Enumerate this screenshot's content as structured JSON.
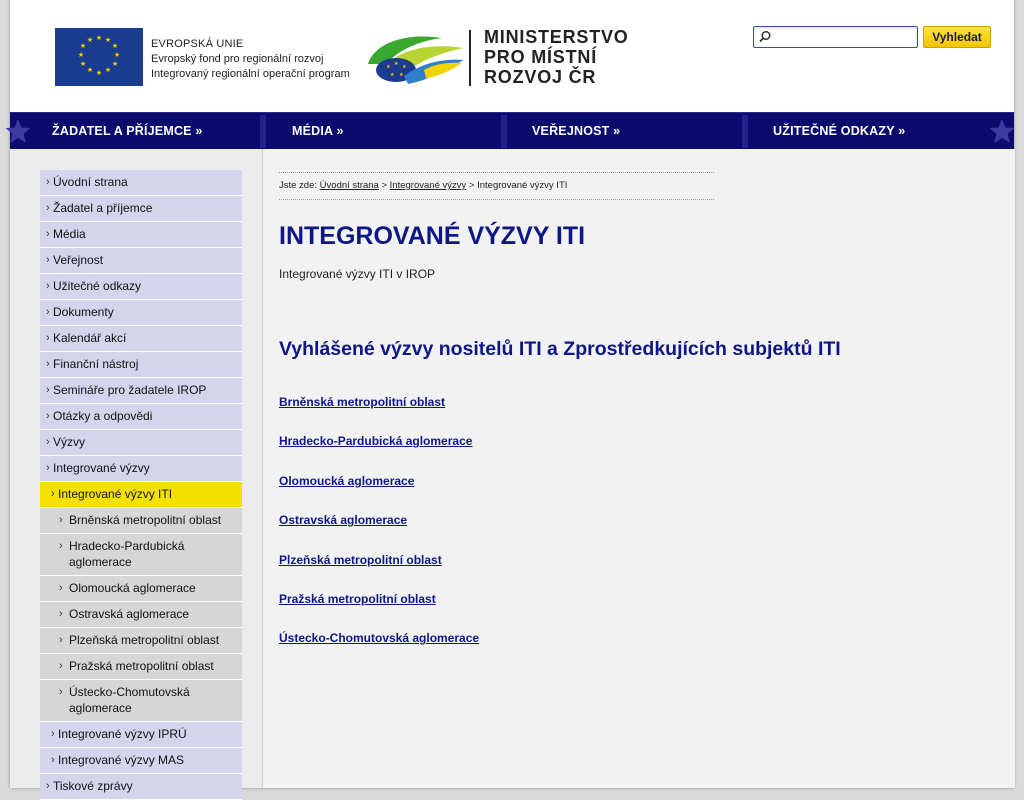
{
  "header": {
    "eu_lines": [
      "EVROPSKÁ UNIE",
      "Evropský fond pro regionální rozvoj",
      "Integrovaný regionální operační program"
    ],
    "ministry_lines": [
      "MINISTERSTVO",
      "PRO MÍSTNÍ",
      "ROZVOJ ČR"
    ],
    "search_placeholder": "",
    "search_button": "Vyhledat"
  },
  "topnav": [
    {
      "label": "ŽADATEL A PŘÍJEMCE »"
    },
    {
      "label": "MÉDIA »"
    },
    {
      "label": "VEŘEJNOST »"
    },
    {
      "label": "UŽITEČNÉ ODKAZY »"
    }
  ],
  "sidebar": {
    "items": [
      {
        "label": "Úvodní strana",
        "level": 1
      },
      {
        "label": "Žadatel a příjemce",
        "level": 1
      },
      {
        "label": "Média",
        "level": 1
      },
      {
        "label": "Veřejnost",
        "level": 1
      },
      {
        "label": "Užitečné odkazy",
        "level": 1
      },
      {
        "label": "Dokumenty",
        "level": 1
      },
      {
        "label": "Kalendář akcí",
        "level": 1
      },
      {
        "label": "Finanční nástroj",
        "level": 1
      },
      {
        "label": "Semináře pro žadatele IROP",
        "level": 1
      },
      {
        "label": "Otázky a odpovědi",
        "level": 1
      },
      {
        "label": "Výzvy",
        "level": 1
      },
      {
        "label": "Integrované výzvy",
        "level": 1
      },
      {
        "label": "Integrované výzvy ITI",
        "level": 2,
        "active": true
      },
      {
        "label": "Brněnská metropolitní oblast",
        "level": 3
      },
      {
        "label": "Hradecko-Pardubická aglomerace",
        "level": 3
      },
      {
        "label": "Olomoucká aglomerace",
        "level": 3
      },
      {
        "label": "Ostravská aglomerace",
        "level": 3
      },
      {
        "label": "Plzeňská metropolitní oblast",
        "level": 3
      },
      {
        "label": "Pražská metropolitní oblast",
        "level": 3
      },
      {
        "label": "Ústecko-Chomutovská aglomerace",
        "level": 3
      },
      {
        "label": "Integrované výzvy IPRÚ",
        "level": 2
      },
      {
        "label": "Integrované výzvy MAS",
        "level": 2
      },
      {
        "label": "Tiskové zprávy",
        "level": 1
      }
    ]
  },
  "breadcrumb": {
    "prefix": "Jste zde:",
    "home": "Úvodní strana",
    "sep1": ">",
    "parent": "Integrované výzvy",
    "sep2": ">",
    "current": "Integrované výzvy ITI"
  },
  "main": {
    "title": "INTEGROVANÉ VÝZVY ITI",
    "subtitle": "Integrované výzvy ITI v IROP",
    "section_heading": "Vyhlášené výzvy nositelů ITI a Zprostředkujících subjektů ITI",
    "links": [
      "Brněnská metropolitní oblast",
      "Hradecko-Pardubická aglomerace",
      "Olomoucká aglomerace",
      "Ostravská aglomerace",
      "Plzeňská metropolitní oblast",
      "Pražská metropolitní oblast",
      "Ústecko-Chomutovská aglomerace"
    ]
  },
  "colors": {
    "nav_bg": "#0b0b6e",
    "title": "#0d1785",
    "sidebar_item": "#d4d4ec",
    "sidebar_active": "#f5e100",
    "search_button": "#f2c400"
  }
}
